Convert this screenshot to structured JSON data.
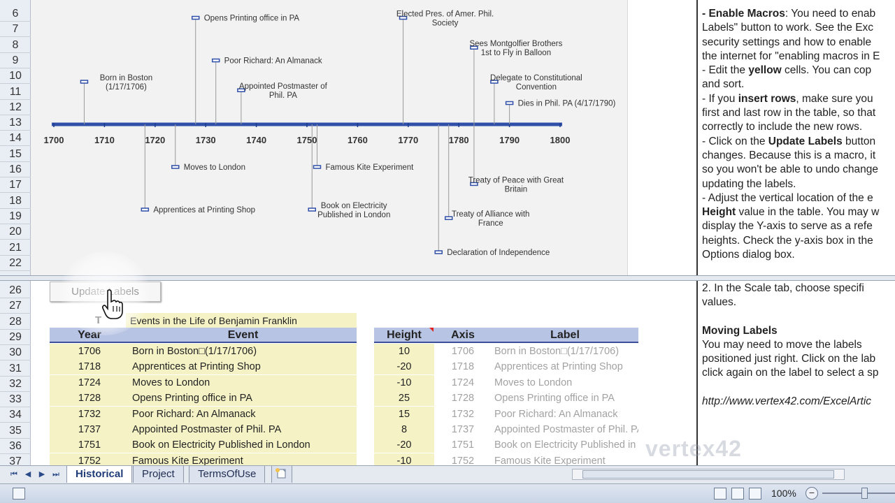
{
  "rows_top": [
    "6",
    "7",
    "8",
    "9",
    "10",
    "11",
    "12",
    "13",
    "14",
    "15",
    "16",
    "17",
    "18",
    "19",
    "20",
    "21",
    "22"
  ],
  "rows_bottom": [
    "26",
    "27",
    "28",
    "29",
    "30",
    "31",
    "32",
    "33",
    "34",
    "35",
    "36",
    "37"
  ],
  "timeline": {
    "axis_ticks": [
      "1700",
      "1710",
      "1720",
      "1730",
      "1740",
      "1750",
      "1760",
      "1770",
      "1780",
      "1790",
      "1800"
    ],
    "events": [
      {
        "label": "Born in Boston\n(1/17/1706)",
        "year": 1706,
        "height": 10
      },
      {
        "label": "Apprentices at Printing  Shop",
        "year": 1718,
        "height": -20
      },
      {
        "label": "Moves to London",
        "year": 1724,
        "height": -10
      },
      {
        "label": "Opens Printing office in PA",
        "year": 1728,
        "height": 25
      },
      {
        "label": "Poor Richard: An Almanack",
        "year": 1732,
        "height": 15
      },
      {
        "label": "Appointed Postmaster of\nPhil. PA",
        "year": 1737,
        "height": 8
      },
      {
        "label": "Book on Electricity\nPublished in London",
        "year": 1751,
        "height": -20
      },
      {
        "label": "Famous Kite Experiment",
        "year": 1752,
        "height": -10
      },
      {
        "label": "Elected Pres. of Amer. Phil.\nSociety",
        "year": 1769,
        "height": 25
      },
      {
        "label": "Declaration of Independence",
        "year": 1776,
        "height": -30
      },
      {
        "label": "Treaty of Alliance  with\nFrance",
        "year": 1778,
        "height": -22
      },
      {
        "label": "Treaty of Peace with Great\nBritain",
        "year": 1783,
        "height": -14
      },
      {
        "label": "Sees Montgolfier Brothers\n1st to Fly in Balloon",
        "year": 1783,
        "height": 18
      },
      {
        "label": "Delegate to Constitutional\nConvention",
        "year": 1787,
        "height": 10
      },
      {
        "label": "Dies in Phil. PA (4/17/1790)",
        "year": 1790,
        "height": 5
      }
    ]
  },
  "notes_top": [
    {
      "bold": "- Enable Macros",
      "text": ":  You need to enab"
    },
    {
      "bold": "",
      "text": "Labels\" button to work. See the Exc"
    },
    {
      "bold": "",
      "text": "security settings and how to enable"
    },
    {
      "bold": "",
      "text": "the internet  for \"enabling macros in E"
    },
    {
      "bold": "",
      "text": "- Edit the ",
      "bold2": "yellow",
      "text2": " cells. You can cop"
    },
    {
      "bold": "",
      "text": "and sort."
    },
    {
      "bold": "",
      "text": "- If you ",
      "bold2": "insert rows",
      "text2": ", make sure you"
    },
    {
      "bold": "",
      "text": "first and last row in the table, so that"
    },
    {
      "bold": "",
      "text": "correctly to include the new rows."
    },
    {
      "bold": "",
      "text": "- Click on the ",
      "bold2": "Update Labels",
      "text2": " button"
    },
    {
      "bold": "",
      "text": "changes. Because this is a macro, it"
    },
    {
      "bold": "",
      "text": "so you won't be able to undo change"
    },
    {
      "bold": "",
      "text": "updating the labels."
    },
    {
      "bold": "",
      "text": "- Adjust the vertical location of the e"
    },
    {
      "bold": "Height",
      "text": " value in the table. You may w"
    },
    {
      "bold": "",
      "text": "display the Y-axis to serve as a refe"
    },
    {
      "bold": "",
      "text": "heights. Check the y-axis box in the"
    },
    {
      "bold": "",
      "text": "Options dialog box."
    }
  ],
  "notes_bottom": {
    "line1": "  2. In the Scale tab, choose specifi",
    "line2": "values.",
    "heading": "Moving Labels",
    "line3": "  You may need to move the labels",
    "line4": "positioned just right. Click on the lab",
    "line5": "click again on the label to select a sp",
    "url": "http://www.vertex42.com/ExcelArtic"
  },
  "button": {
    "update_labels": "Update Labels"
  },
  "table": {
    "title_prefix": "T",
    "title": "Events in the Life of Benjamin Franklin",
    "headers": {
      "year": "Year",
      "event": "Event",
      "height": "Height",
      "axis": "Axis",
      "label": "Label"
    },
    "rows": [
      {
        "year": "1706",
        "event": "Born in Boston□(1/17/1706)",
        "height": "10",
        "axis": "1706",
        "label": "Born in Boston□(1/17/1706)"
      },
      {
        "year": "1718",
        "event": "Apprentices at Printing Shop",
        "height": "-20",
        "axis": "1718",
        "label": "Apprentices at Printing Shop"
      },
      {
        "year": "1724",
        "event": "Moves to London",
        "height": "-10",
        "axis": "1724",
        "label": "Moves to London"
      },
      {
        "year": "1728",
        "event": "Opens Printing office in PA",
        "height": "25",
        "axis": "1728",
        "label": "Opens Printing office in PA"
      },
      {
        "year": "1732",
        "event": "Poor Richard: An Almanack",
        "height": "15",
        "axis": "1732",
        "label": "Poor Richard: An Almanack"
      },
      {
        "year": "1737",
        "event": "Appointed Postmaster of Phil. PA",
        "height": "8",
        "axis": "1737",
        "label": "Appointed Postmaster of Phil. PA"
      },
      {
        "year": "1751",
        "event": "Book on Electricity Published in London",
        "height": "-20",
        "axis": "1751",
        "label": "Book on Electricity Published in Lo"
      },
      {
        "year": "1752",
        "event": "Famous Kite Experiment",
        "height": "-10",
        "axis": "1752",
        "label": "Famous Kite Experiment"
      }
    ]
  },
  "tabs": [
    {
      "label": "Historical",
      "active": true
    },
    {
      "label": "Project",
      "active": false
    },
    {
      "label": "TermsOfUse",
      "active": false
    }
  ],
  "nav": {
    "first": "⏮",
    "prev": "◀",
    "next": "▶",
    "last": "⏭"
  },
  "status": {
    "zoom": "100%",
    "minus": "−"
  },
  "watermark": "vertex42",
  "colors": {
    "axis_blue": "#2f4fa8",
    "header_blue": "#b8c4e4",
    "yellow_cell": "#f5f3c6"
  }
}
